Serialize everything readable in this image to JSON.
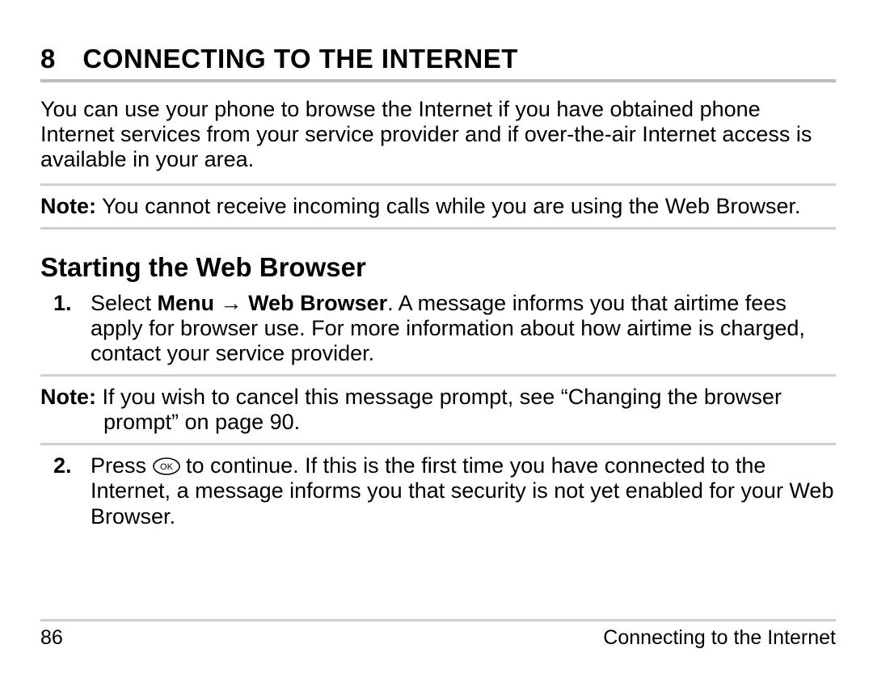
{
  "chapter": {
    "number": "8",
    "title": "CONNECTING TO THE INTERNET"
  },
  "intro": "You can use your phone to browse the Internet if you have obtained phone Internet services from your service provider and if over-the-air Internet access is available in your area.",
  "note1": {
    "label": "Note:",
    "text": "You cannot receive incoming calls while you are using the Web Browser."
  },
  "section_heading": "Starting the Web Browser",
  "step1": {
    "prefix": "Select ",
    "menu1": "Menu",
    "arrow": " → ",
    "menu2": "Web Browser",
    "suffix": ". A message informs you that airtime fees apply for browser use. For more information about how airtime is charged, contact your service provider."
  },
  "note2": {
    "label": "Note:",
    "text": "If you wish to cancel this message prompt, see “Changing the browser prompt” on page 90."
  },
  "step2": {
    "prefix": "Press ",
    "suffix": " to continue. If this is the first time you have connected to the Internet, a message informs you that security is not yet enabled for your Web Browser."
  },
  "footer": {
    "page": "86",
    "title": "Connecting to the Internet"
  }
}
